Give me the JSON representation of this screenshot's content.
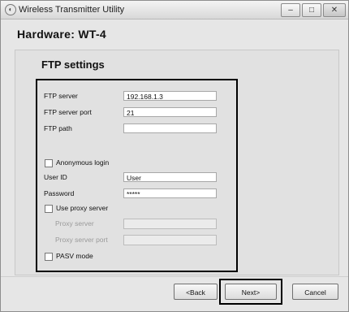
{
  "window": {
    "title": "Wireless Transmitter Utility",
    "controls": {
      "minimize": "–",
      "maximize": "□",
      "close": "✕"
    }
  },
  "header": {
    "title": "Hardware: WT-4"
  },
  "panel": {
    "title": "FTP settings"
  },
  "form": {
    "ftp_server": {
      "label": "FTP server",
      "value": "192.168.1.3"
    },
    "ftp_port": {
      "label": "FTP server port",
      "value": "21"
    },
    "ftp_path": {
      "label": "FTP path",
      "value": ""
    },
    "anonymous_login": {
      "label": "Anonymous login",
      "checked": false
    },
    "user_id": {
      "label": "User ID",
      "value": "User"
    },
    "password": {
      "label": "Password",
      "value": "*****"
    },
    "use_proxy": {
      "label": "Use proxy server",
      "checked": false
    },
    "proxy_server": {
      "label": "Proxy server",
      "value": ""
    },
    "proxy_port": {
      "label": "Proxy server port",
      "value": ""
    },
    "pasv_mode": {
      "label": "PASV mode",
      "checked": false
    }
  },
  "buttons": {
    "back": "<Back",
    "next": "Next>",
    "cancel": "Cancel"
  }
}
